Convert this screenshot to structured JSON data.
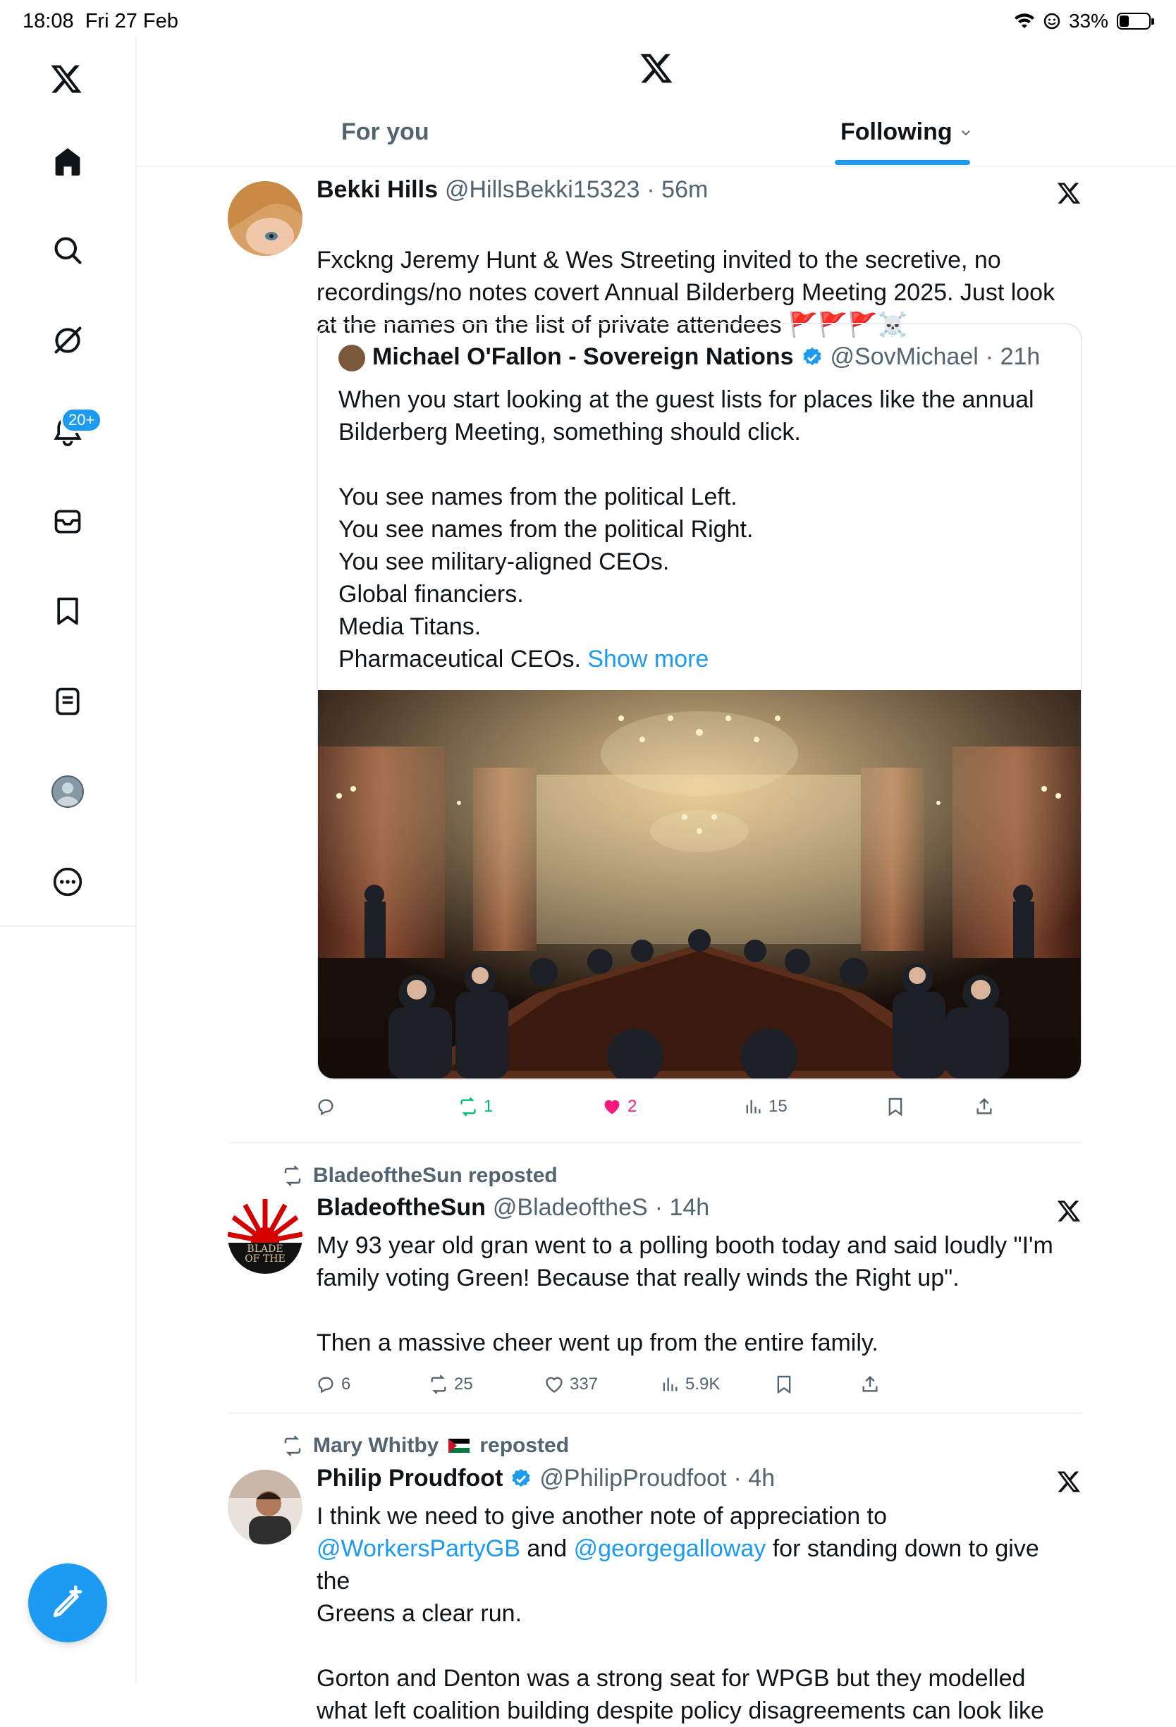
{
  "status_bar": {
    "time": "18:08",
    "date": "Fri 27 Feb",
    "battery": "33%",
    "battery_level": 0.33
  },
  "nav": {
    "notifications_badge": "20+"
  },
  "header": {
    "tabs": [
      {
        "label": "For you",
        "active": false
      },
      {
        "label": "Following",
        "active": true
      }
    ]
  },
  "tweets": [
    {
      "name": "Bekki Hills",
      "handle": "@HillsBekki15323",
      "time": "· 56m",
      "text": "Fxckng Jeremy Hunt & Wes Streeting invited to the  secretive, no recordings/no notes covert Annual Bilderberg Meeting 2025. Just look at the names on the list of private attendees",
      "emojis": "🚩🚩🚩☠️",
      "quote": {
        "name": "Michael O'Fallon - Sovereign Nations",
        "handle": "@SovMichael",
        "time": "· 21h",
        "text": "When you start looking at the guest lists for places like the annual Bilderberg Meeting, something should click.\n\nYou see names from the political Left.\nYou see names from the political Right.\nYou see military-aligned CEOs.\nGlobal financiers.\nMedia Titans.\nPharmaceutical CEOs.",
        "show_more": "Show more"
      },
      "actions": {
        "replies": "",
        "reposts": "1",
        "likes": "2",
        "views": "15"
      },
      "liked": true,
      "reposted": true
    },
    {
      "reposted_by": "BladeoftheSun reposted",
      "name": "BladeoftheSun",
      "handle": "@BladeoftheS",
      "time": "· 14h",
      "text": "My 93 year old gran went to a polling booth today and said loudly \"I'm family voting Green! Because that really winds the Right up\".\n\nThen a massive cheer went up from the entire family.",
      "avatar_text": "BLADE\nOF THE",
      "actions": {
        "replies": "6",
        "reposts": "25",
        "likes": "337",
        "views": "5.9K"
      }
    },
    {
      "reposted_by_name": "Mary Whitby",
      "reposted_by_suffix": "reposted",
      "name": "Philip Proudfoot",
      "handle": "@PhilipProudfoot",
      "time": "· 4h",
      "text_1": "I think we need to give another note of appreciation to",
      "mention_1": "@WorkersPartyGB",
      "text_2": "and",
      "mention_2": "@georgegalloway",
      "text_3": "for standing down to give the",
      "text_4": "Greens a clear run.",
      "text_5": "Gorton and Denton was a strong seat for WPGB but they modelled what left coalition building despite policy disagreements can look like"
    }
  ]
}
